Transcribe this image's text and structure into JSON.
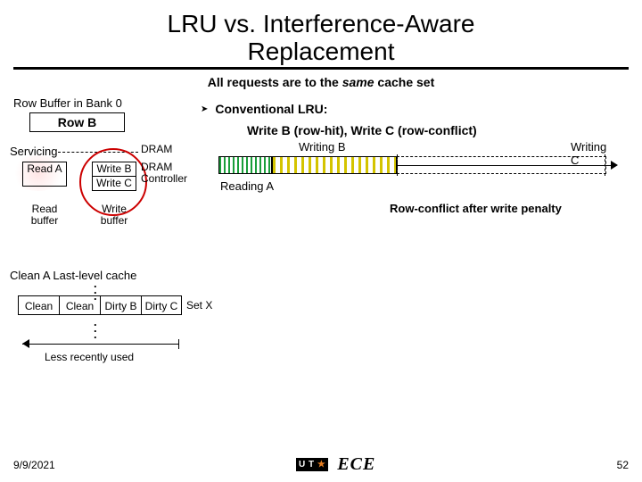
{
  "title_line1": "LRU vs. Interference-Aware",
  "title_line2": "Replacement",
  "subtitle_pre": "All requests are to the ",
  "subtitle_em": "same",
  "subtitle_post": " cache set",
  "rowbuf_label": "Row Buffer in Bank 0",
  "rowbuf_content": "Row B",
  "servicing": "Servicing",
  "dram": "DRAM",
  "read_a": "Read A",
  "write_b": "Write B",
  "write_c": "Write C",
  "dram_controller": "DRAM\nController",
  "read_buffer": "Read\nbuffer",
  "write_buffer": "Write\nbuffer",
  "bullet": "Conventional LRU:",
  "subbullet": "Write B (row-hit), Write C (row-conflict)",
  "tl_reading": "Reading A",
  "tl_writingB": "Writing B",
  "tl_writingC": "Writing C",
  "row_conflict": "Row-conflict after write penalty",
  "clean_a_cache": "Clean A Last-level cache",
  "cache": [
    "Clean",
    "Clean",
    "Dirty B",
    "Dirty C"
  ],
  "set_x": "Set X",
  "less": "Less recently used",
  "date": "9/9/2021",
  "logo_ut_pre": "U T",
  "ece": "ECE",
  "page": "52"
}
